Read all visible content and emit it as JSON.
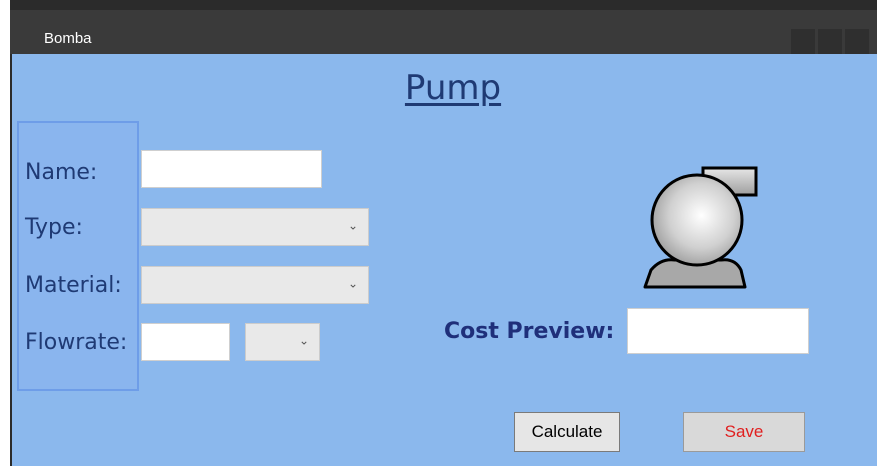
{
  "window": {
    "title": "Bomba"
  },
  "form": {
    "heading": "Pump",
    "name_label": "Name:",
    "name_value": "",
    "type_label": "Type:",
    "type_selected": "",
    "material_label": "Material:",
    "material_selected": "",
    "flowrate_label": "Flowrate:",
    "flowrate_value": "",
    "flowrate_unit_selected": ""
  },
  "preview": {
    "cost_label": "Cost Preview:",
    "cost_value": ""
  },
  "buttons": {
    "calculate_label": "Calculate",
    "save_label": "Save"
  },
  "icons": {
    "pump": "pump-icon",
    "dropdown": "chevron-down-icon"
  },
  "colors": {
    "client_background": "#8bb8ed",
    "label_text": "#1f3a74",
    "save_text": "#e02020"
  }
}
